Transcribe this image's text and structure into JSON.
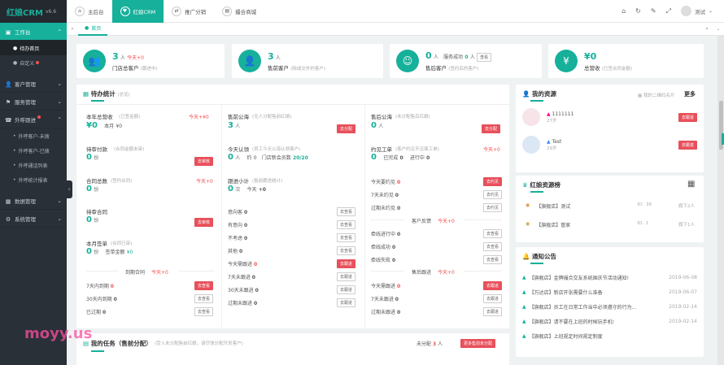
{
  "app": {
    "logo": "红娘CRM",
    "version": "v6.6"
  },
  "sidebar": {
    "groups": [
      {
        "label": "工作台",
        "icon": "desktop-icon",
        "expanded": true
      },
      {
        "label": "客户管理",
        "icon": "user-icon"
      },
      {
        "label": "服务管理",
        "icon": "service-icon"
      },
      {
        "label": "外呼跟进",
        "icon": "phone-icon",
        "expanded": true
      },
      {
        "label": "数据管理",
        "icon": "data-icon"
      },
      {
        "label": "系统管理",
        "icon": "gear-icon"
      }
    ],
    "workbench_items": [
      "待办首页",
      "自定义"
    ],
    "call_items": [
      "外呼客户-未拨",
      "外呼客户-已拨",
      "外呼通话列表",
      "外呼统计报表"
    ]
  },
  "topbar": {
    "tabs": [
      "主后台",
      "红娘CRM",
      "推广分销",
      "撮合商城"
    ],
    "active_tab": 1,
    "user": "测试"
  },
  "crumb": {
    "label": "首页"
  },
  "stats": [
    {
      "value": "3",
      "unit": "人",
      "delta": "今天+0",
      "label": "门店总客户",
      "hint": "(跟进中)"
    },
    {
      "value": "3",
      "unit": "人",
      "label": "售前客户",
      "hint": "(除成交外的客户)"
    },
    {
      "value": "0",
      "unit": "人",
      "extra_label": "服务成功",
      "extra_value": "0",
      "extra_unit": "人",
      "extra_btn": "查看",
      "label": "售后客户",
      "hint": "(签约后的客户)"
    },
    {
      "value": "¥0",
      "label": "总营收",
      "hint": "(已签合同金额)"
    }
  ],
  "todo": {
    "title": "待办统计",
    "title_hint": "(总览)",
    "col1": {
      "revenue": {
        "label": "本年总营收",
        "hint": "(已签金额)",
        "delta": "今天+¥0",
        "value": "¥0",
        "month_label": "本月",
        "month_value": "¥0"
      },
      "pending_pay": {
        "label": "待审付款",
        "hint": "(合同金额未审)",
        "value": "0",
        "unit": "份",
        "btn": "去审核"
      },
      "contracts": {
        "label": "合同总数",
        "hint": "(签约合同)",
        "value": "0",
        "unit": "份",
        "delta": "今天+0"
      },
      "pending_contract": {
        "label": "待审合同",
        "value": "0",
        "unit": "份",
        "btn": "去审核"
      },
      "monthly_deal": {
        "label": "本月签单",
        "hint": "(合同已审)",
        "value": "0",
        "unit": "份",
        "sub_label": "签单金额",
        "sub_value": "¥0"
      },
      "due_header": "到期合同",
      "due_delta": "今天+0",
      "due_rows": [
        {
          "label": "7天内到期",
          "value": "0",
          "btn": "去查看",
          "red": true
        },
        {
          "label": "30天内到期",
          "value": "0",
          "btn": "去查看"
        },
        {
          "label": "已过期",
          "value": "0",
          "btn": "去查看"
        }
      ]
    },
    "col2": {
      "sea": {
        "label": "售前公海",
        "hint": "(无人分配售前红娘)",
        "value": "3",
        "unit": "人",
        "btn": "去分配"
      },
      "claim": {
        "label": "今天认领",
        "hint": "(员工今天公海认领客户)",
        "value": "0",
        "unit": "人",
        "about": "约",
        "about_value": "0",
        "reg_label": "门店新会员数",
        "reg_value": "20/20"
      },
      "follow": {
        "label": "跟进小计",
        "hint": "(售前跟进统计)",
        "value": "0",
        "unit": "次",
        "today": "今天",
        "today_delta": "+0"
      },
      "rows": [
        {
          "label": "意向客",
          "value": "0",
          "btn": "去查看"
        },
        {
          "label": "有意向",
          "value": "0",
          "btn": "去查看"
        },
        {
          "label": "不考虑",
          "value": "0",
          "btn": "去查看"
        },
        {
          "label": "其他",
          "value": "0",
          "btn": "去查看"
        },
        {
          "label": "今天需跟进",
          "value": "0",
          "btn": "去跟进",
          "red": true
        },
        {
          "label": "7天未跟进",
          "value": "0",
          "btn": "去跟进"
        },
        {
          "label": "30天未跟进",
          "value": "0",
          "btn": "去跟进"
        },
        {
          "label": "过期未跟进",
          "value": "0",
          "btn": "去跟进"
        }
      ]
    },
    "col3": {
      "sea": {
        "label": "售后公海",
        "hint": "(未分配售后红娘)",
        "value": "0",
        "unit": "人",
        "btn": "去分配"
      },
      "tickets": {
        "label": "约见工单",
        "hint": "(客户约见不见面工单)",
        "delta": "今天+0",
        "value": "0",
        "done_label": "已完成",
        "done_value": "0",
        "doing_label": "进行中",
        "doing_value": "0"
      },
      "meet_rows": [
        {
          "label": "今天要约见",
          "value": "0",
          "btn": "去约见",
          "red": true
        },
        {
          "label": "7天未约见",
          "value": "0",
          "btn": "去约见"
        },
        {
          "label": "过期未约见",
          "value": "0",
          "btn": "去约见"
        }
      ],
      "feedback_header": "客户反馈",
      "feedback_delta": "今天+0",
      "feedback_rows": [
        {
          "label": "牵线进行中",
          "value": "0",
          "btn": "去查看"
        },
        {
          "label": "牵线成功",
          "value": "0",
          "btn": "去查看"
        },
        {
          "label": "牵线失败",
          "value": "0",
          "btn": "去查看"
        }
      ],
      "after_header": "售后跟进",
      "after_delta": "今天+0",
      "after_rows": [
        {
          "label": "今天需跟进",
          "value": "0",
          "btn": "去跟进",
          "red": true
        },
        {
          "label": "7天未跟进",
          "value": "0",
          "btn": "去跟进"
        },
        {
          "label": "过期未跟进",
          "value": "0",
          "btn": "去跟进"
        }
      ]
    }
  },
  "tasks": {
    "title": "我的任务（售前分配）",
    "hint": "(受入未分配售前红娘，请尽快分配开发客户)",
    "unassigned_label": "未分配",
    "unassigned_value": "3",
    "unassigned_unit": "人",
    "btn": "更多售前未分配"
  },
  "resources": {
    "title": "我的资源",
    "qr_label": "我的二维码名片",
    "more": "更多",
    "items": [
      {
        "name": "1111111",
        "age": "27岁",
        "btn": "去跟进"
      },
      {
        "name": "Test",
        "age": "29岁",
        "btn": "去跟进"
      }
    ]
  },
  "ranking": {
    "title": "红娘资源榜",
    "items": [
      {
        "name": "【旗舰店】测试",
        "id_label": "ID:",
        "id": "39",
        "count": "旗下2人"
      },
      {
        "name": "【旗舰店】管家",
        "id_label": "ID:",
        "id": "1",
        "count": "旗下1人"
      }
    ]
  },
  "notices": {
    "title": "通知公告",
    "items": [
      {
        "text": "【旗舰店】金牌撮合交友系统国庆节活动通知!",
        "date": "2019-06-08"
      },
      {
        "text": "【万达店】新店开张需要什么准备",
        "date": "2019-06-07"
      },
      {
        "text": "【旗舰店】员工在日常工作当中必须遵守的行为...",
        "date": "2019-02-14"
      },
      {
        "text": "【旗舰店】请不要在上班的时候玩手机!",
        "date": "2019-02-14"
      },
      {
        "text": "【旗舰店】上班规定时间规定制度",
        "date": ""
      }
    ]
  },
  "watermark": "moyy.us",
  "colors": {
    "accent": "#16b09b",
    "sidebar": "#2a3038",
    "danger": "#e8505b"
  }
}
